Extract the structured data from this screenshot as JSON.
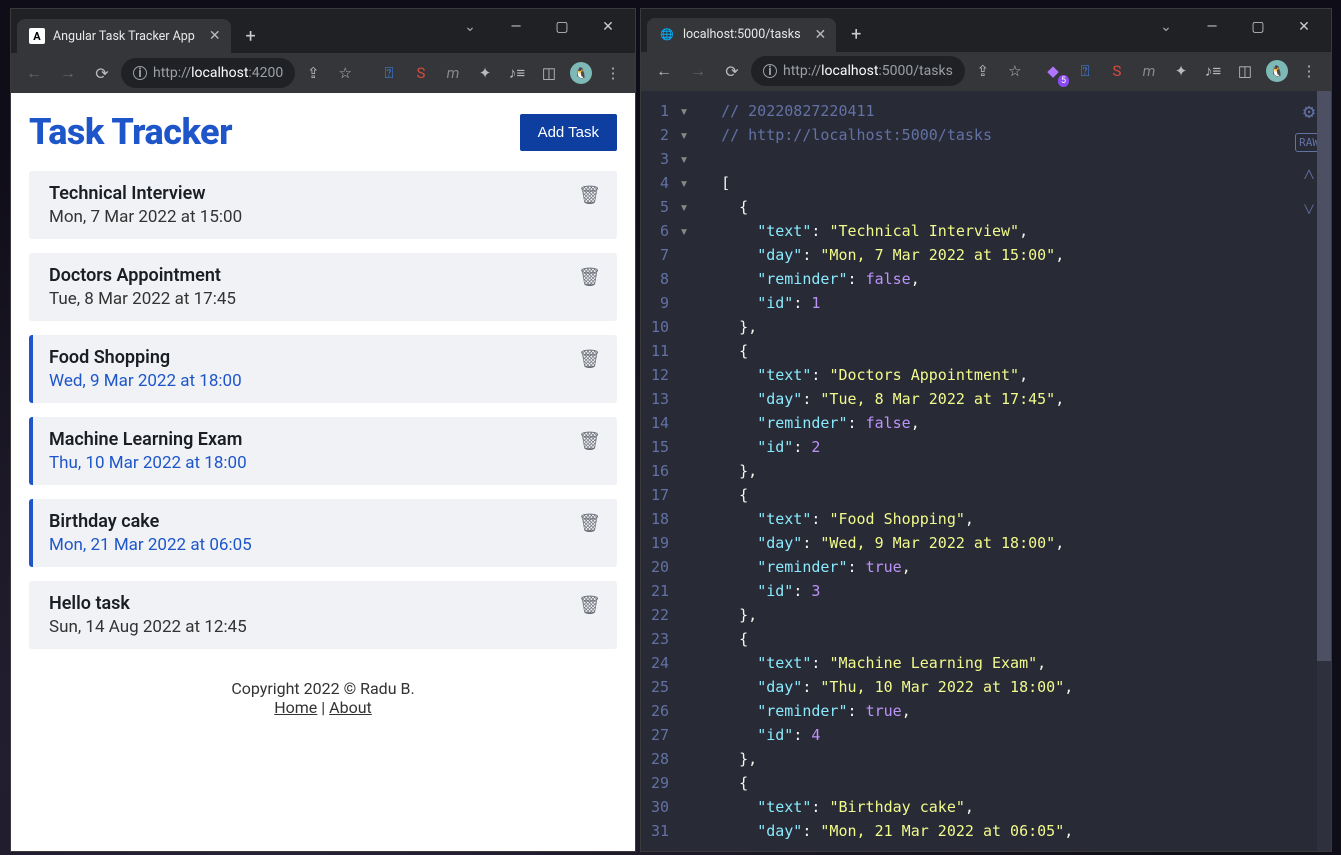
{
  "leftWindow": {
    "tabTitle": "Angular Task Tracker App",
    "newTabPlus": "+",
    "winCtrls": {
      "chev": "⌄",
      "min": "—",
      "max": "▢",
      "close": "✕"
    },
    "url": {
      "scheme": "http://",
      "host": "localhost",
      "port": ":4200"
    },
    "app": {
      "title": "Task Tracker",
      "addTaskLabel": "Add Task",
      "tasks": [
        {
          "text": "Technical Interview",
          "day": "Mon, 7 Mar 2022 at 15:00",
          "reminder": false
        },
        {
          "text": "Doctors Appointment",
          "day": "Tue, 8 Mar 2022 at 17:45",
          "reminder": false
        },
        {
          "text": "Food Shopping",
          "day": "Wed, 9 Mar 2022 at 18:00",
          "reminder": true
        },
        {
          "text": "Machine Learning Exam",
          "day": "Thu, 10 Mar 2022 at 18:00",
          "reminder": true
        },
        {
          "text": "Birthday cake",
          "day": "Mon, 21 Mar 2022 at 06:05",
          "reminder": true
        },
        {
          "text": "Hello task",
          "day": "Sun, 14 Aug 2022 at 12:45",
          "reminder": false
        }
      ],
      "footerCopyright": "Copyright 2022 © Radu B.",
      "footerHome": "Home",
      "footerSep": " | ",
      "footerAbout": "About"
    }
  },
  "rightWindow": {
    "tabTitle": "localhost:5000/tasks",
    "newTabPlus": "+",
    "winCtrls": {
      "chev": "⌄",
      "min": "—",
      "max": "▢",
      "close": "✕"
    },
    "url": {
      "scheme": "http://",
      "host": "localhost",
      "port": ":5000/tasks"
    },
    "extBadgeCount": "5",
    "json": {
      "commentTimestamp": "// 20220827220411",
      "commentUrl": "// http://localhost:5000/tasks",
      "visibleLines": 31,
      "items": [
        {
          "text": "Technical Interview",
          "day": "Mon, 7 Mar 2022 at 15:00",
          "reminder": false,
          "id": 1
        },
        {
          "text": "Doctors Appointment",
          "day": "Tue, 8 Mar 2022 at 17:45",
          "reminder": false,
          "id": 2
        },
        {
          "text": "Food Shopping",
          "day": "Wed, 9 Mar 2022 at 18:00",
          "reminder": true,
          "id": 3
        },
        {
          "text": "Machine Learning Exam",
          "day": "Thu, 10 Mar 2022 at 18:00",
          "reminder": true,
          "id": 4
        },
        {
          "text": "Birthday cake",
          "day": "Mon, 21 Mar 2022 at 06:05"
        }
      ]
    }
  }
}
